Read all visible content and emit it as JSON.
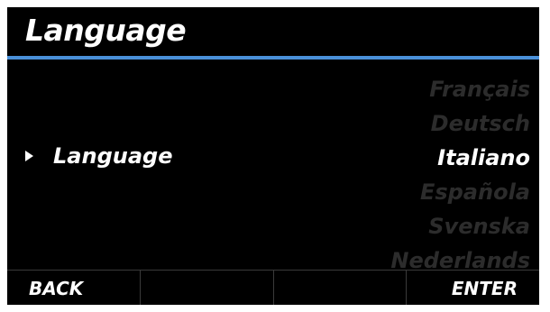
{
  "header": {
    "title": "Language"
  },
  "colors": {
    "accent": "#4a90d9",
    "background": "#000000",
    "dimmed_text": "#2c2c2c",
    "text": "#ffffff"
  },
  "setting": {
    "icon": "triangle-right-icon",
    "label": "Language"
  },
  "options": [
    {
      "label": "Français",
      "selected": false
    },
    {
      "label": "Deutsch",
      "selected": false
    },
    {
      "label": "Italiano",
      "selected": true
    },
    {
      "label": "Española",
      "selected": false
    },
    {
      "label": "Svenska",
      "selected": false
    },
    {
      "label": "Nederlands",
      "selected": false
    }
  ],
  "softkeys": [
    "BACK",
    "",
    "",
    "ENTER"
  ]
}
